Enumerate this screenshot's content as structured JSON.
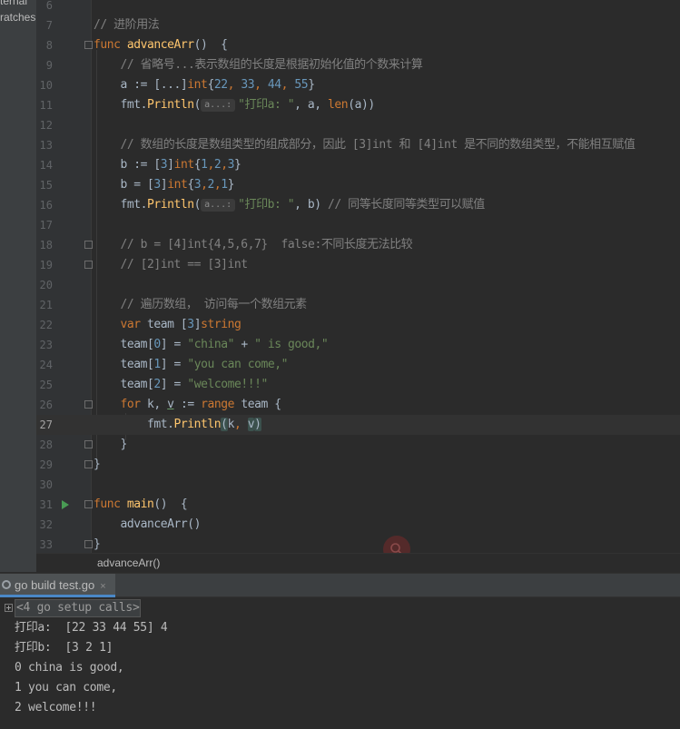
{
  "project": {
    "items": [
      "ternal",
      "ratches"
    ]
  },
  "editor": {
    "lines": [
      {
        "n": "6"
      },
      {
        "n": "7"
      },
      {
        "n": "8"
      },
      {
        "n": "9"
      },
      {
        "n": "10"
      },
      {
        "n": "11"
      },
      {
        "n": "12"
      },
      {
        "n": "13"
      },
      {
        "n": "14"
      },
      {
        "n": "15"
      },
      {
        "n": "16"
      },
      {
        "n": "17"
      },
      {
        "n": "18"
      },
      {
        "n": "19"
      },
      {
        "n": "20"
      },
      {
        "n": "21"
      },
      {
        "n": "22"
      },
      {
        "n": "23"
      },
      {
        "n": "24"
      },
      {
        "n": "25"
      },
      {
        "n": "26"
      },
      {
        "n": "27"
      },
      {
        "n": "28"
      },
      {
        "n": "29"
      },
      {
        "n": "30"
      },
      {
        "n": "31"
      },
      {
        "n": "32"
      },
      {
        "n": "33"
      }
    ],
    "t": {
      "l7_cm": "// 进阶用法",
      "l8_kw": "func ",
      "l8_fn": "advanceArr",
      "l8_rest": "()  {",
      "l9_cm": "// 省略号...表示数组的长度是根据初始化值的个数来计算",
      "l10_a": "a := [...]",
      "l10_int": "int",
      "l10_b": "{",
      "l10_n1": "22",
      "l10_c1": ", ",
      "l10_n2": "33",
      "l10_c2": ", ",
      "l10_n3": "44",
      "l10_c3": ", ",
      "l10_n4": "55",
      "l10_e": "}",
      "l11_a": "fmt.",
      "l11_fn": "Println",
      "l11_p": "(",
      "l11_hint": "a...:",
      "l11_str": "\"打印a: \"",
      "l11_m": ", a, ",
      "l11_len": "len",
      "l11_e": "(a))",
      "l13_cm": "// 数组的长度是数组类型的组成部分，因此 [3]int 和 [4]int 是不同的数组类型，不能相互赋值",
      "l14_a": "b := [",
      "l14_n": "3",
      "l14_b": "]",
      "l14_int": "int",
      "l14_c": "{",
      "l14_v1": "1",
      "l14_s1": ",",
      "l14_v2": "2",
      "l14_s2": ",",
      "l14_v3": "3",
      "l14_e": "}",
      "l15_a": "b = [",
      "l15_n": "3",
      "l15_b": "]",
      "l15_int": "int",
      "l15_c": "{",
      "l15_v1": "3",
      "l15_s1": ",",
      "l15_v2": "2",
      "l15_s2": ",",
      "l15_v3": "1",
      "l15_e": "}",
      "l16_a": "fmt.",
      "l16_fn": "Println",
      "l16_p": "(",
      "l16_hint": "a...:",
      "l16_str": "\"打印b: \"",
      "l16_m": ", b) ",
      "l16_cm": "// 同等长度同等类型可以赋值",
      "l18_cm": "// b = [4]int{4,5,6,7}  false:不同长度无法比较",
      "l19_cm": "// [2]int == [3]int",
      "l21_cm": "// 遍历数组， 访问每一个数组元素",
      "l22_kw": "var ",
      "l22_a": "team [",
      "l22_n": "3",
      "l22_b": "]",
      "l22_t": "string",
      "l23_a": "team[",
      "l23_n": "0",
      "l23_b": "] = ",
      "l23_s1": "\"china\"",
      "l23_c": " + ",
      "l23_s2": "\" is good,\"",
      "l24_a": "team[",
      "l24_n": "1",
      "l24_b": "] = ",
      "l24_s": "\"you can come,\"",
      "l25_a": "team[",
      "l25_n": "2",
      "l25_b": "] = ",
      "l25_s": "\"welcome!!!\"",
      "l26_kw": "for ",
      "l26_k": "k, ",
      "l26_v": "v",
      "l26_op": " := ",
      "l26_range": "range ",
      "l26_e": "team {",
      "l27_a": "fmt.",
      "l27_fn": "Println",
      "l27_p": "(",
      "l27_k": "k",
      "l27_c": ", ",
      "l27_v": "v",
      "l27_e": ")",
      "l28": "}",
      "l29": "}",
      "l31_kw": "func ",
      "l31_fn": "main",
      "l31_rest": "()  {",
      "l32": "advanceArr()",
      "l33": "}"
    }
  },
  "breadcrumb": "advanceArr()",
  "run": {
    "tab_label": "go build test.go",
    "close": "×",
    "collapsed": "<4 go setup calls>",
    "output": [
      "打印a:  [22 33 44 55] 4",
      "打印b:  [3 2 1]",
      "0 china is good,",
      "1 you can come,",
      "2 welcome!!!"
    ]
  },
  "colors": {
    "keyword": "#cc7832",
    "function": "#ffc66d",
    "number": "#6897bb",
    "string": "#6a8759",
    "comment": "#808080",
    "text": "#a9b7c6",
    "run_icon": "#499c54"
  }
}
